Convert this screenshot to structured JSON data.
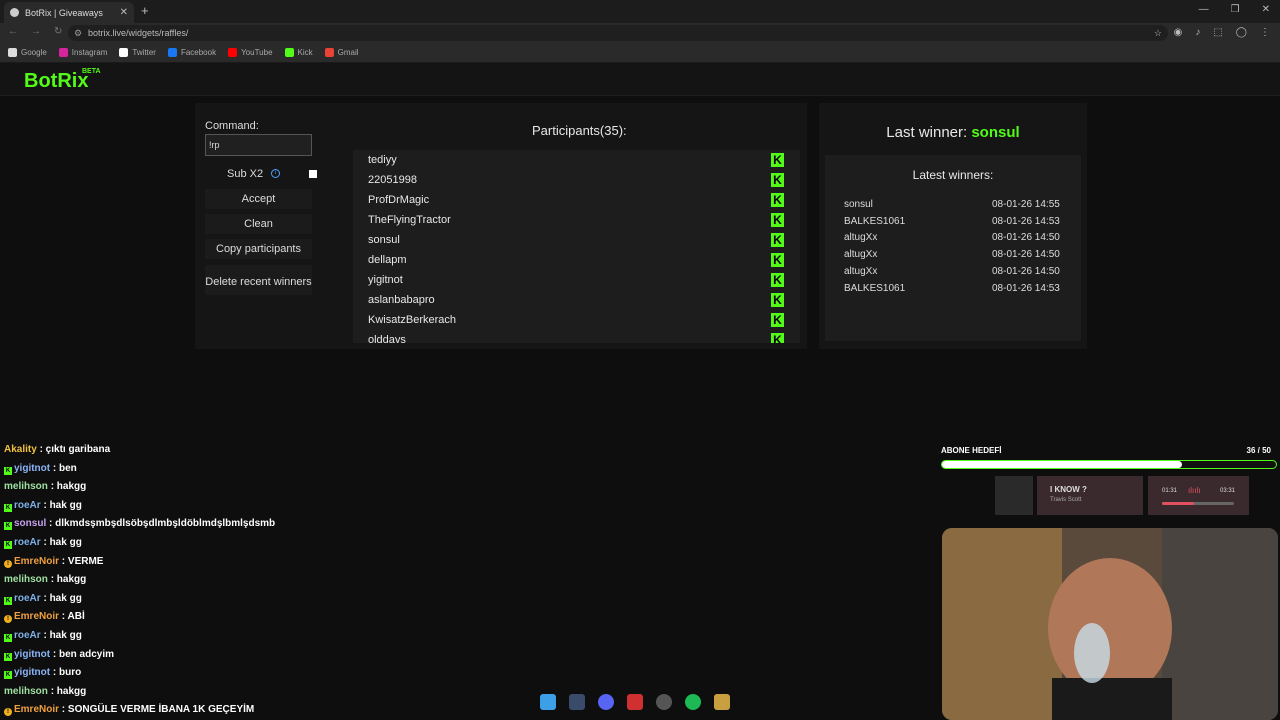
{
  "browser": {
    "tab_title": "BotRix | Giveaways",
    "url": "botrix.live/widgets/raffles/",
    "bookmarks": [
      {
        "label": "Google",
        "icon": "google-icon",
        "color": "#dddddd"
      },
      {
        "label": "Instagram",
        "icon": "instagram-icon",
        "color": "#d6249f"
      },
      {
        "label": "Twitter",
        "icon": "x-icon",
        "color": "#ffffff"
      },
      {
        "label": "Facebook",
        "icon": "facebook-icon",
        "color": "#1877f2"
      },
      {
        "label": "YouTube",
        "icon": "youtube-icon",
        "color": "#ff0000"
      },
      {
        "label": "Kick",
        "icon": "kick-icon",
        "color": "#53fc18"
      },
      {
        "label": "Gmail",
        "icon": "gmail-icon",
        "color": "#ea4335"
      }
    ]
  },
  "brand": {
    "logo": "BotRix",
    "beta": "BETA",
    "accent": "#53fc18"
  },
  "controls": {
    "command_label": "Command:",
    "command_value": "!rp",
    "sub_label": "Sub X2",
    "accept": "Accept",
    "clean": "Clean",
    "copy": "Copy participants",
    "delete_recent": "Delete recent winners"
  },
  "participants": {
    "title": "Participants(35):",
    "names": [
      "tediyy",
      "22051998",
      "ProfDrMagic",
      "TheFlyingTractor",
      "sonsul",
      "dellapm",
      "yigitnot",
      "aslanbabapro",
      "KwisatzBerkerach",
      "olddays"
    ]
  },
  "winners": {
    "last_label": "Last winner:",
    "last_name": "sonsul",
    "latest_title": "Latest winners:",
    "list": [
      {
        "name": "sonsul",
        "time": "08-01-26 14:55"
      },
      {
        "name": "BALKES1061",
        "time": "08-01-26 14:53"
      },
      {
        "name": "altugXx",
        "time": "08-01-26 14:50"
      },
      {
        "name": "altugXx",
        "time": "08-01-26 14:50"
      },
      {
        "name": "altugXx",
        "time": "08-01-26 14:50"
      },
      {
        "name": "BALKES1061",
        "time": "08-01-26 14:53"
      }
    ]
  },
  "chat": [
    {
      "badge": "",
      "user": "Akality",
      "color": "#f0c040",
      "msg": ": çıktı garibana"
    },
    {
      "badge": "k",
      "user": "yigitnot",
      "color": "#8ab4f8",
      "msg": ": ben"
    },
    {
      "badge": "",
      "user": "melihson",
      "color": "#9de0a0",
      "msg": ": hakgg"
    },
    {
      "badge": "k",
      "user": "roeAr",
      "color": "#7fb0e8",
      "msg": ": hak gg"
    },
    {
      "badge": "k",
      "user": "sonsul",
      "color": "#c9a0f0",
      "msg": ": dlkmdsşmbşdlsöbşdlmbşldöblmdşlbmlşdsmb"
    },
    {
      "badge": "k",
      "user": "roeAr",
      "color": "#7fb0e8",
      "msg": ": hak gg"
    },
    {
      "badge": "o",
      "user": "EmreNoir",
      "color": "#f0a040",
      "msg": ": VERME"
    },
    {
      "badge": "",
      "user": "melihson",
      "color": "#9de0a0",
      "msg": ": hakgg"
    },
    {
      "badge": "k",
      "user": "roeAr",
      "color": "#7fb0e8",
      "msg": ": hak gg"
    },
    {
      "badge": "o",
      "user": "EmreNoir",
      "color": "#f0a040",
      "msg": ": ABİ"
    },
    {
      "badge": "k",
      "user": "roeAr",
      "color": "#7fb0e8",
      "msg": ": hak gg"
    },
    {
      "badge": "k",
      "user": "yigitnot",
      "color": "#8ab4f8",
      "msg": ": ben adcyim"
    },
    {
      "badge": "k",
      "user": "yigitnot",
      "color": "#8ab4f8",
      "msg": ": buro"
    },
    {
      "badge": "",
      "user": "melihson",
      "color": "#9de0a0",
      "msg": ": hakgg"
    },
    {
      "badge": "o",
      "user": "EmreNoir",
      "color": "#f0a040",
      "msg": ": SONGÜLE VERME İBANA 1K GEÇEYİM"
    }
  ],
  "sub_goal": {
    "title": "ABONE HEDEFİ",
    "count": "36 / 50",
    "progress": 0.72
  },
  "spotify": {
    "title": "I KNOW ?",
    "artist": "Travis Scott",
    "elapsed": "01:31",
    "total": "03:31",
    "progress": 0.45
  }
}
